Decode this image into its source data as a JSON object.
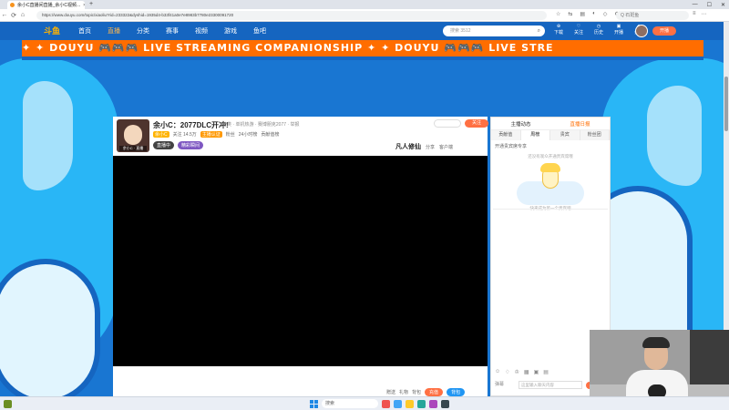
{
  "browser": {
    "tab_title": "余小C直播间直播_余小C视频...",
    "tab_close": "×",
    "newtab": "+",
    "url": "https://www.douyu.com/topic/xiaoliu?rid=233322&dyshid=1935d4-b33f41a0e7e8983b7780e23300091720",
    "search_placeholder": "Q 石斑鱼",
    "win_min": "—",
    "win_max": "☐",
    "win_close": "✕"
  },
  "site": {
    "logo": "斗鱼",
    "nav": [
      "首页",
      "直播",
      "分类",
      "赛事",
      "视频",
      "游戏",
      "鱼吧"
    ],
    "nav_active_index": 1,
    "search_text": "搜索 3512",
    "top_icons": [
      "下载",
      "关注",
      "历史",
      "开播",
      "会员"
    ],
    "top_button": "开播"
  },
  "banner": {
    "text": "✦ ✦ DOUYU 🎮🎮🎮 LIVE STREAMING COMPANIONSHIP ✦ ✦ DOUYU 🎮🎮🎮 LIVE STRE"
  },
  "room": {
    "title": "余小C：2077DLC开冲!",
    "meta": "分类 · 单机热游 · 赛博朋克2077 · 举报",
    "line2": [
      "余小C",
      "关注 14.5万",
      "主播认证"
    ],
    "line2_tail": [
      "粉丝",
      "24小时榜",
      "贡献值榜"
    ],
    "pills": [
      "直播中",
      "精彩瞬间"
    ],
    "follow": "关注",
    "brand": "凡人修仙",
    "right_items": [
      "分享",
      "客户端"
    ],
    "avatar_tag": "余小C · 直播"
  },
  "sidebar": {
    "head": [
      "主播动态",
      "直播日报"
    ],
    "tabs": [
      "贡献值",
      "周榜",
      "贵宾",
      "粉丝团"
    ],
    "sub": "开通贵宾席专享",
    "empty_top": "还没有观众开通贵宾席哦",
    "empty_bottom": "快来成为第一个贵宾吧",
    "chat_placeholder": "这里输入聊天内容",
    "send": "发送",
    "chat_left": "弹幕"
  },
  "below": {
    "items": [
      "赠送",
      "礼物",
      "背包"
    ],
    "btn_orange": "充值",
    "btn_blue": "背包"
  },
  "taskbar": {
    "search": "搜索"
  }
}
